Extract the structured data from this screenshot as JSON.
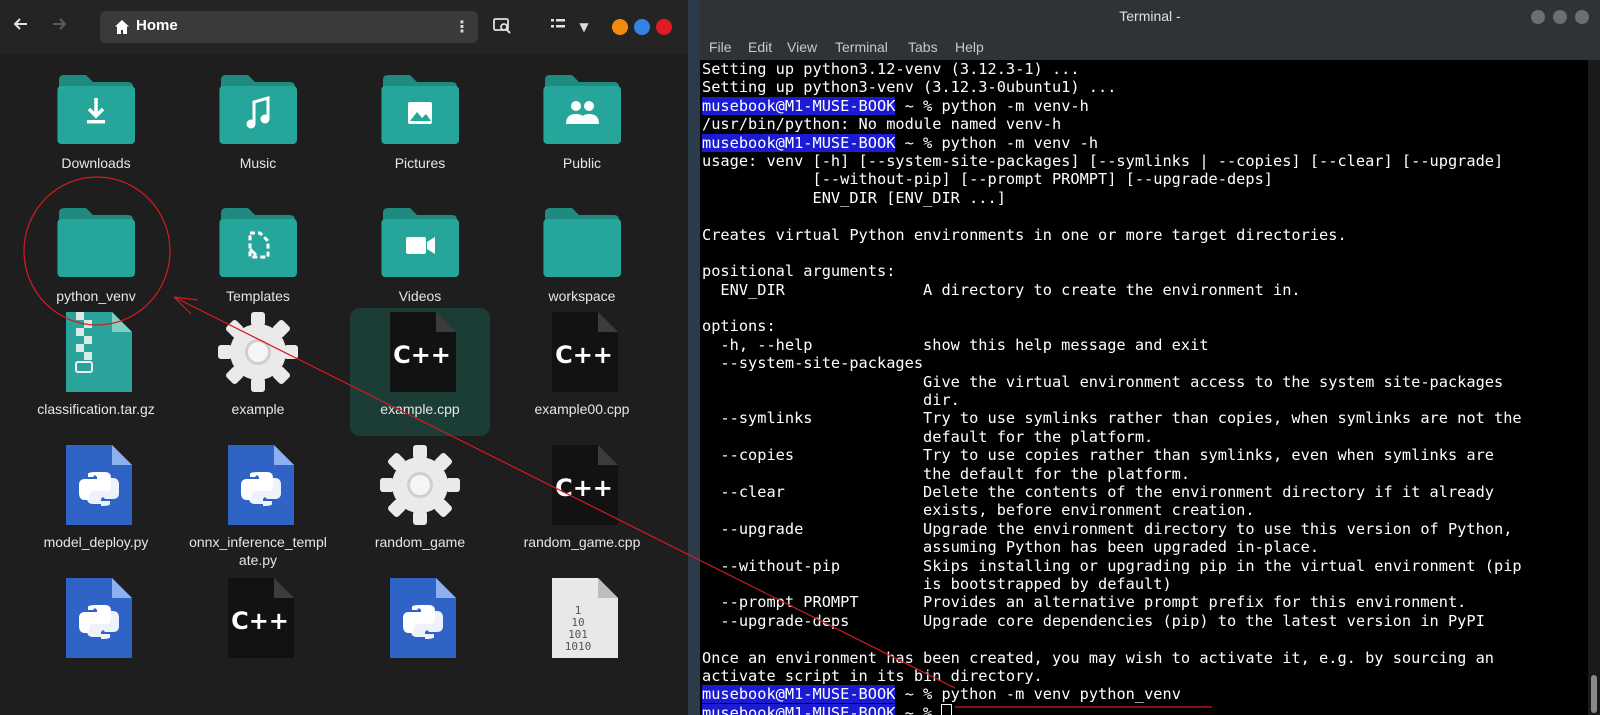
{
  "file_manager": {
    "location": "Home",
    "accent_color": "#26a69a",
    "window_buttons": [
      "minimize-icon",
      "maximize-icon",
      "close-icon"
    ],
    "items": [
      {
        "name": "Downloads",
        "icon": "folder-downloads-icon"
      },
      {
        "name": "Music",
        "icon": "folder-music-icon"
      },
      {
        "name": "Pictures",
        "icon": "folder-pictures-icon"
      },
      {
        "name": "Public",
        "icon": "folder-public-icon"
      },
      {
        "name": "python_venv",
        "icon": "folder-icon"
      },
      {
        "name": "Templates",
        "icon": "folder-templates-icon"
      },
      {
        "name": "Videos",
        "icon": "folder-videos-icon"
      },
      {
        "name": "workspace",
        "icon": "folder-icon"
      },
      {
        "name": "classification.tar.gz",
        "icon": "archive-icon"
      },
      {
        "name": "example",
        "icon": "executable-gear-icon"
      },
      {
        "name": "example.cpp",
        "icon": "cpp-file-icon",
        "selected": true
      },
      {
        "name": "example00.cpp",
        "icon": "cpp-file-icon"
      },
      {
        "name": "model_deploy.py",
        "icon": "python-file-icon"
      },
      {
        "name": "onnx_inference_template.py",
        "icon": "python-file-icon"
      },
      {
        "name": "random_game",
        "icon": "executable-gear-icon"
      },
      {
        "name": "random_game.cpp",
        "icon": "cpp-file-icon"
      },
      {
        "name": "",
        "icon": "python-file-icon"
      },
      {
        "name": "",
        "icon": "cpp-file-icon"
      },
      {
        "name": "",
        "icon": "python-file-icon"
      },
      {
        "name": "",
        "icon": "binary-file-icon"
      }
    ]
  },
  "terminal": {
    "title": "Terminal -",
    "menu": [
      "File",
      "Edit",
      "View",
      "Terminal",
      "Tabs",
      "Help"
    ],
    "prompt_host": "musebook@M1-MUSE-BOOK",
    "prompt_suffix": " ~ % ",
    "lines": [
      {
        "text": "Setting up python3.12-venv (3.12.3-1) ..."
      },
      {
        "text": "Setting up python3-venv (3.12.3-0ubuntu1) ..."
      },
      {
        "prompt": true,
        "text": "python -m venv-h"
      },
      {
        "text": "/usr/bin/python: No module named venv-h"
      },
      {
        "prompt": true,
        "text": "python -m venv -h"
      },
      {
        "text": "usage: venv [-h] [--system-site-packages] [--symlinks | --copies] [--clear] [--upgrade]"
      },
      {
        "text": "            [--without-pip] [--prompt PROMPT] [--upgrade-deps]"
      },
      {
        "text": "            ENV_DIR [ENV_DIR ...]"
      },
      {
        "text": ""
      },
      {
        "text": "Creates virtual Python environments in one or more target directories."
      },
      {
        "text": ""
      },
      {
        "text": "positional arguments:"
      },
      {
        "text": "  ENV_DIR               A directory to create the environment in."
      },
      {
        "text": ""
      },
      {
        "text": "options:"
      },
      {
        "text": "  -h, --help            show this help message and exit"
      },
      {
        "text": "  --system-site-packages"
      },
      {
        "text": "                        Give the virtual environment access to the system site-packages"
      },
      {
        "text": "                        dir."
      },
      {
        "text": "  --symlinks            Try to use symlinks rather than copies, when symlinks are not the"
      },
      {
        "text": "                        default for the platform."
      },
      {
        "text": "  --copies              Try to use copies rather than symlinks, even when symlinks are"
      },
      {
        "text": "                        the default for the platform."
      },
      {
        "text": "  --clear               Delete the contents of the environment directory if it already"
      },
      {
        "text": "                        exists, before environment creation."
      },
      {
        "text": "  --upgrade             Upgrade the environment directory to use this version of Python,"
      },
      {
        "text": "                        assuming Python has been upgraded in-place."
      },
      {
        "text": "  --without-pip         Skips installing or upgrading pip in the virtual environment (pip"
      },
      {
        "text": "                        is bootstrapped by default)"
      },
      {
        "text": "  --prompt PROMPT       Provides an alternative prompt prefix for this environment."
      },
      {
        "text": "  --upgrade-deps        Upgrade core dependencies (pip) to the latest version in PyPI"
      },
      {
        "text": ""
      },
      {
        "text": "Once an environment has been created, you may wish to activate it, e.g. by sourcing an"
      },
      {
        "text": "activate script in its bin directory."
      },
      {
        "prompt": true,
        "text": "python -m venv python_venv"
      },
      {
        "prompt": true,
        "text": "",
        "cursor": true
      }
    ]
  },
  "annotation_color": "#d21c1c"
}
